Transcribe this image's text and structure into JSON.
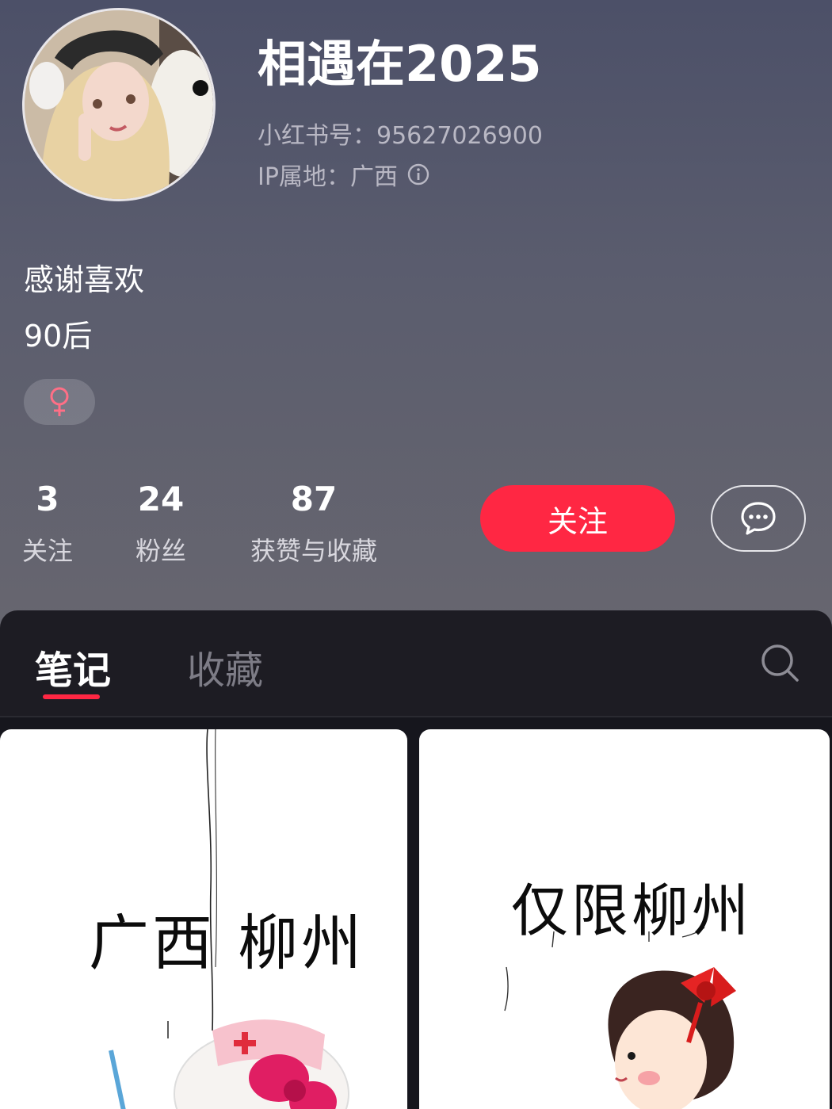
{
  "profile": {
    "nickname": "相遇在2025",
    "id_line": "小红书号：95627026900",
    "ip_line": "IP属地：广西",
    "bio_line_1": "感谢喜欢",
    "bio_line_2": "90后",
    "gender_icon": "female-icon"
  },
  "stats": [
    {
      "value": "3",
      "label": "关注"
    },
    {
      "value": "24",
      "label": "粉丝"
    },
    {
      "value": "87",
      "label": "获赞与收藏"
    }
  ],
  "actions": {
    "follow_label": "关注",
    "message_icon": "chat-bubble-icon"
  },
  "tabs": {
    "active": "笔记",
    "inactive": "收藏",
    "search_icon": "search-icon"
  },
  "notes": [
    {
      "title": "广西 柳州"
    },
    {
      "title": "仅限柳州"
    }
  ],
  "colors": {
    "accent": "#ff2743",
    "header_top": "#4c5068",
    "tab_bg": "#1d1c23"
  }
}
